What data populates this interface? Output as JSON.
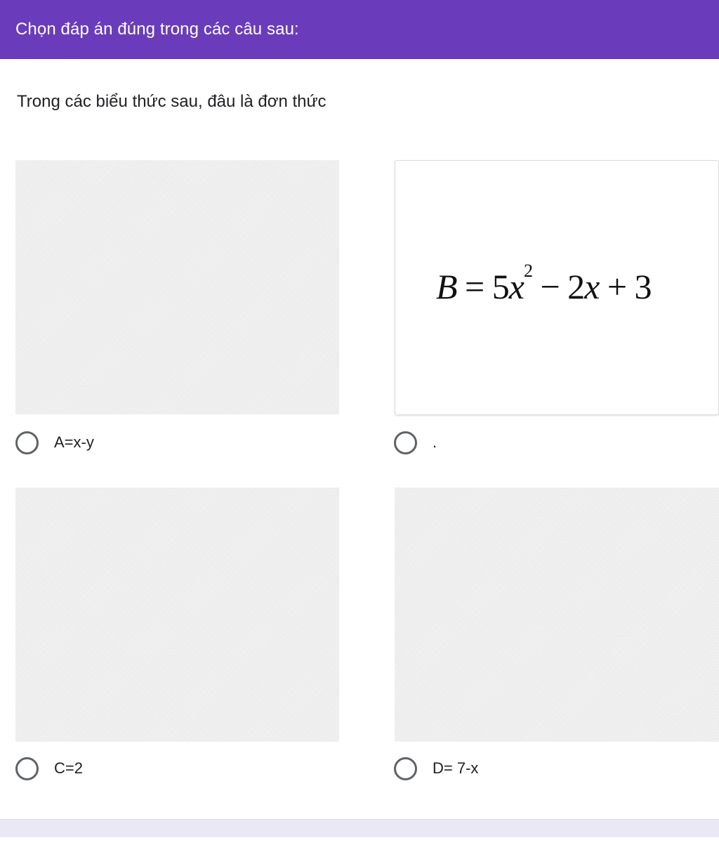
{
  "header": {
    "title": "Chọn đáp án đúng trong các câu sau:"
  },
  "question": {
    "text": "Trong các biểu thức sau, đâu là đơn thức"
  },
  "formula_b": {
    "var_b": "B",
    "eq": " = 5",
    "var_x1": "x",
    "exp": "2",
    "minus": " − 2",
    "var_x2": "x",
    "plus": " + 3"
  },
  "options": [
    {
      "label": "A=x-y"
    },
    {
      "label": "."
    },
    {
      "label": "C=2"
    },
    {
      "label": "D= 7-x"
    }
  ],
  "colors": {
    "header_bg": "#6a3cbc",
    "image_placeholder": "#eeeeee",
    "radio_border": "#5f6368",
    "footer_bar": "#ebe8f5"
  }
}
